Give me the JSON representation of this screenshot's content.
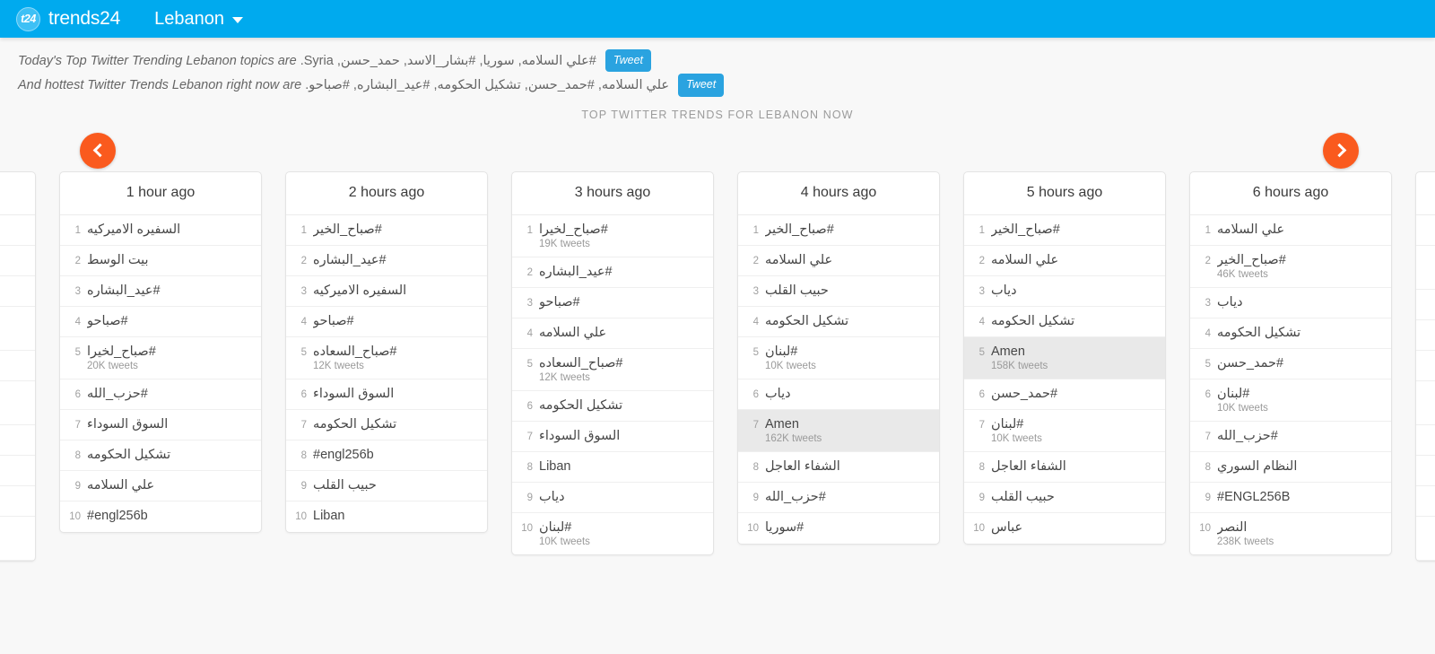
{
  "header": {
    "logo_badge": "t24",
    "brand": "trends24",
    "region": "Lebanon",
    "caret_icon": "chevron-down-icon"
  },
  "intro": {
    "line1_prefix": "Today's Top Twitter Trending Lebanon topics are",
    "line1_topics": "#علي السلامه, سوريا, #بشار_الاسد, حمد_حسن, Syria.",
    "line1_tweet_label": "Tweet",
    "line2_prefix": "And hottest Twitter Trends Lebanon right now are",
    "line2_topics": "علي السلامه, #حمد_حسن, تشكيل الحكومه, #عيد_البشاره, #صباحو.",
    "line2_tweet_label": "Tweet"
  },
  "section_title": "TOP TWITTER TRENDS FOR LEBANON NOW",
  "nav": {
    "prev_icon": "chevron-left-icon",
    "next_icon": "chevron-right-icon"
  },
  "colors": {
    "header_bg": "#00AAEE",
    "accent_orange": "#FA5A1E",
    "tweet_blue": "#2AA3E0",
    "page_bg": "#F8F8F8",
    "highlight_row": "#E9E9E9"
  },
  "columns": [
    {
      "title": "1 hour ago",
      "items": [
        {
          "rank": "1",
          "topic": "السفيره الاميركيه",
          "rtl": true,
          "count": "",
          "highlight": false
        },
        {
          "rank": "2",
          "topic": "بيت الوسط",
          "rtl": true,
          "count": "",
          "highlight": false
        },
        {
          "rank": "3",
          "topic": "#عيد_البشاره",
          "rtl": true,
          "count": "",
          "highlight": false
        },
        {
          "rank": "4",
          "topic": "#صباحو",
          "rtl": true,
          "count": "",
          "highlight": false
        },
        {
          "rank": "5",
          "topic": "#صباح_لخيرا",
          "rtl": true,
          "count": "20K tweets",
          "highlight": false
        },
        {
          "rank": "6",
          "topic": "#حزب_الله",
          "rtl": true,
          "count": "",
          "highlight": false
        },
        {
          "rank": "7",
          "topic": "السوق السوداء",
          "rtl": true,
          "count": "",
          "highlight": false
        },
        {
          "rank": "8",
          "topic": "تشكيل الحكومه",
          "rtl": true,
          "count": "",
          "highlight": false
        },
        {
          "rank": "9",
          "topic": "علي السلامه",
          "rtl": true,
          "count": "",
          "highlight": false
        },
        {
          "rank": "10",
          "topic": "#engl256b",
          "rtl": false,
          "count": "",
          "highlight": false
        }
      ]
    },
    {
      "title": "2 hours ago",
      "items": [
        {
          "rank": "1",
          "topic": "#صباح_الخير",
          "rtl": true,
          "count": "",
          "highlight": false
        },
        {
          "rank": "2",
          "topic": "#عيد_البشاره",
          "rtl": true,
          "count": "",
          "highlight": false
        },
        {
          "rank": "3",
          "topic": "السفيره الاميركيه",
          "rtl": true,
          "count": "",
          "highlight": false
        },
        {
          "rank": "4",
          "topic": "#صباحو",
          "rtl": true,
          "count": "",
          "highlight": false
        },
        {
          "rank": "5",
          "topic": "#صباح_السعاده",
          "rtl": true,
          "count": "12K tweets",
          "highlight": false
        },
        {
          "rank": "6",
          "topic": "السوق السوداء",
          "rtl": true,
          "count": "",
          "highlight": false
        },
        {
          "rank": "7",
          "topic": "تشكيل الحكومه",
          "rtl": true,
          "count": "",
          "highlight": false
        },
        {
          "rank": "8",
          "topic": "#engl256b",
          "rtl": false,
          "count": "",
          "highlight": false
        },
        {
          "rank": "9",
          "topic": "حبيب القلب",
          "rtl": true,
          "count": "",
          "highlight": false
        },
        {
          "rank": "10",
          "topic": "Liban",
          "rtl": false,
          "count": "",
          "highlight": false
        }
      ]
    },
    {
      "title": "3 hours ago",
      "items": [
        {
          "rank": "1",
          "topic": "#صباح_لخيرا",
          "rtl": true,
          "count": "19K tweets",
          "highlight": false
        },
        {
          "rank": "2",
          "topic": "#عيد_البشاره",
          "rtl": true,
          "count": "",
          "highlight": false
        },
        {
          "rank": "3",
          "topic": "#صباحو",
          "rtl": true,
          "count": "",
          "highlight": false
        },
        {
          "rank": "4",
          "topic": "علي السلامه",
          "rtl": true,
          "count": "",
          "highlight": false
        },
        {
          "rank": "5",
          "topic": "#صباح_السعاده",
          "rtl": true,
          "count": "12K tweets",
          "highlight": false
        },
        {
          "rank": "6",
          "topic": "تشكيل الحكومه",
          "rtl": true,
          "count": "",
          "highlight": false
        },
        {
          "rank": "7",
          "topic": "السوق السوداء",
          "rtl": true,
          "count": "",
          "highlight": false
        },
        {
          "rank": "8",
          "topic": "Liban",
          "rtl": false,
          "count": "",
          "highlight": false
        },
        {
          "rank": "9",
          "topic": "دياب",
          "rtl": true,
          "count": "",
          "highlight": false
        },
        {
          "rank": "10",
          "topic": "#لبنان",
          "rtl": true,
          "count": "10K tweets",
          "highlight": false
        }
      ]
    },
    {
      "title": "4 hours ago",
      "items": [
        {
          "rank": "1",
          "topic": "#صباح_الخير",
          "rtl": true,
          "count": "",
          "highlight": false
        },
        {
          "rank": "2",
          "topic": "علي السلامه",
          "rtl": true,
          "count": "",
          "highlight": false
        },
        {
          "rank": "3",
          "topic": "حبيب القلب",
          "rtl": true,
          "count": "",
          "highlight": false
        },
        {
          "rank": "4",
          "topic": "تشكيل الحكومه",
          "rtl": true,
          "count": "",
          "highlight": false
        },
        {
          "rank": "5",
          "topic": "#لبنان",
          "rtl": true,
          "count": "10K tweets",
          "highlight": false
        },
        {
          "rank": "6",
          "topic": "دياب",
          "rtl": true,
          "count": "",
          "highlight": false
        },
        {
          "rank": "7",
          "topic": "Amen",
          "rtl": false,
          "count": "162K tweets",
          "highlight": true
        },
        {
          "rank": "8",
          "topic": "الشفاء العاجل",
          "rtl": true,
          "count": "",
          "highlight": false
        },
        {
          "rank": "9",
          "topic": "#حزب_الله",
          "rtl": true,
          "count": "",
          "highlight": false
        },
        {
          "rank": "10",
          "topic": "#سوريا",
          "rtl": true,
          "count": "",
          "highlight": false
        }
      ]
    },
    {
      "title": "5 hours ago",
      "items": [
        {
          "rank": "1",
          "topic": "#صباح_الخير",
          "rtl": true,
          "count": "",
          "highlight": false
        },
        {
          "rank": "2",
          "topic": "علي السلامه",
          "rtl": true,
          "count": "",
          "highlight": false
        },
        {
          "rank": "3",
          "topic": "دياب",
          "rtl": true,
          "count": "",
          "highlight": false
        },
        {
          "rank": "4",
          "topic": "تشكيل الحكومه",
          "rtl": true,
          "count": "",
          "highlight": false
        },
        {
          "rank": "5",
          "topic": "Amen",
          "rtl": false,
          "count": "158K tweets",
          "highlight": true
        },
        {
          "rank": "6",
          "topic": "#حمد_حسن",
          "rtl": true,
          "count": "",
          "highlight": false
        },
        {
          "rank": "7",
          "topic": "#لبنان",
          "rtl": true,
          "count": "10K tweets",
          "highlight": false
        },
        {
          "rank": "8",
          "topic": "الشفاء العاجل",
          "rtl": true,
          "count": "",
          "highlight": false
        },
        {
          "rank": "9",
          "topic": "حبيب القلب",
          "rtl": true,
          "count": "",
          "highlight": false
        },
        {
          "rank": "10",
          "topic": "عباس",
          "rtl": true,
          "count": "",
          "highlight": false
        }
      ]
    },
    {
      "title": "6 hours ago",
      "items": [
        {
          "rank": "1",
          "topic": "علي السلامه",
          "rtl": true,
          "count": "",
          "highlight": false
        },
        {
          "rank": "2",
          "topic": "#صباح_الخير",
          "rtl": true,
          "count": "46K tweets",
          "highlight": false
        },
        {
          "rank": "3",
          "topic": "دياب",
          "rtl": true,
          "count": "",
          "highlight": false
        },
        {
          "rank": "4",
          "topic": "تشكيل الحكومه",
          "rtl": true,
          "count": "",
          "highlight": false
        },
        {
          "rank": "5",
          "topic": "#حمد_حسن",
          "rtl": true,
          "count": "",
          "highlight": false
        },
        {
          "rank": "6",
          "topic": "#لبنان",
          "rtl": true,
          "count": "10K tweets",
          "highlight": false
        },
        {
          "rank": "7",
          "topic": "#حزب_الله",
          "rtl": true,
          "count": "",
          "highlight": false
        },
        {
          "rank": "8",
          "topic": "النظام السوري",
          "rtl": true,
          "count": "",
          "highlight": false
        },
        {
          "rank": "9",
          "topic": "#ENGL256B",
          "rtl": false,
          "count": "",
          "highlight": false
        },
        {
          "rank": "10",
          "topic": "النصر",
          "rtl": true,
          "count": "238K tweets",
          "highlight": false
        }
      ]
    }
  ]
}
